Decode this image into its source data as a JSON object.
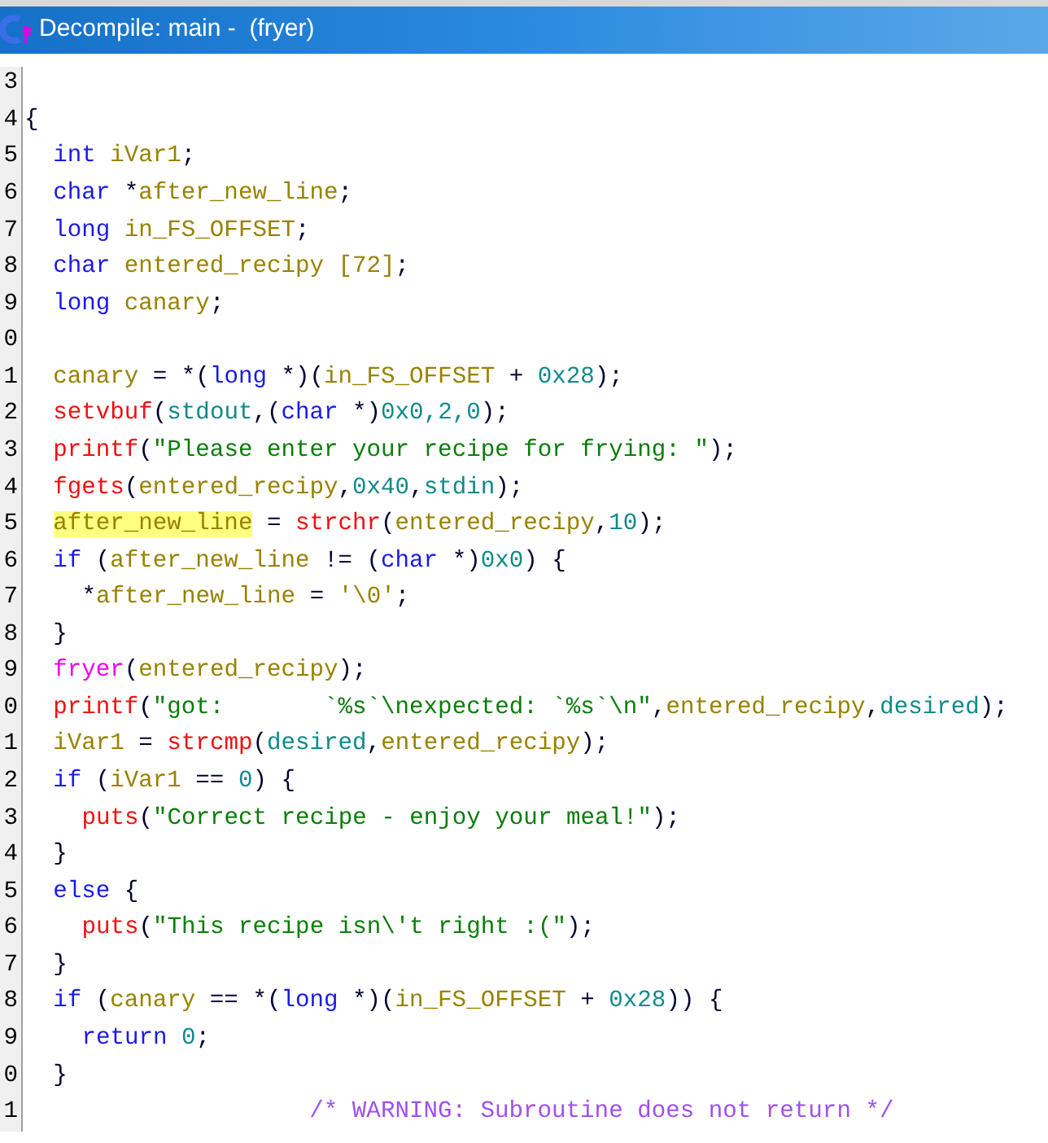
{
  "window": {
    "title": "Decompile: main -  (fryer)"
  },
  "lines": [
    {
      "number": "3"
    },
    {
      "number": "4",
      "tokens": [
        {
          "text": "{",
          "kind": "plain"
        }
      ],
      "children": [
        {
          "number": "5",
          "tokens": [
            {
              "text": "int",
              "kind": "keyword"
            },
            {
              "text": " iVar1",
              "kind": "variable"
            },
            {
              "text": ";",
              "kind": "plain"
            }
          ]
        },
        {
          "number": "6",
          "tokens": [
            {
              "text": "char",
              "kind": "keyword"
            },
            {
              "text": " *",
              "kind": "plain"
            },
            {
              "text": "after_new_line",
              "kind": "variable"
            },
            {
              "text": ";",
              "kind": "plain"
            }
          ]
        },
        {
          "number": "7",
          "tokens": [
            {
              "text": "long",
              "kind": "keyword"
            },
            {
              "text": " in_FS_OFFSET",
              "kind": "variable"
            },
            {
              "text": ";",
              "kind": "plain"
            }
          ]
        },
        {
          "number": "8",
          "tokens": [
            {
              "text": "char",
              "kind": "keyword"
            },
            {
              "text": " entered_recipy [72]",
              "kind": "variable"
            },
            {
              "text": ";",
              "kind": "plain"
            }
          ]
        },
        {
          "number": "9",
          "tokens": [
            {
              "text": "long",
              "kind": "keyword"
            },
            {
              "text": " canary",
              "kind": "variable"
            },
            {
              "text": ";",
              "kind": "plain"
            }
          ]
        },
        {
          "number": "0"
        },
        {
          "number": "1",
          "tokens": [
            {
              "text": "canary",
              "kind": "variable"
            },
            {
              "text": " = *(",
              "kind": "plain"
            },
            {
              "text": "long",
              "kind": "keyword"
            },
            {
              "text": " *)(",
              "kind": "plain"
            },
            {
              "text": "in_FS_OFFSET",
              "kind": "variable"
            },
            {
              "text": " + ",
              "kind": "plain"
            },
            {
              "text": "0x28",
              "kind": "constant"
            },
            {
              "text": ");",
              "kind": "plain"
            }
          ]
        },
        {
          "number": "2",
          "tokens": [
            {
              "text": "setvbuf",
              "kind": "function"
            },
            {
              "text": "(",
              "kind": "plain"
            },
            {
              "text": "stdout",
              "kind": "constant"
            },
            {
              "text": ",(",
              "kind": "plain"
            },
            {
              "text": "char",
              "kind": "keyword"
            },
            {
              "text": " *)",
              "kind": "plain"
            },
            {
              "text": "0x0,2,0",
              "kind": "constant"
            },
            {
              "text": ");",
              "kind": "plain"
            }
          ]
        },
        {
          "number": "3",
          "tokens": [
            {
              "text": "printf",
              "kind": "function"
            },
            {
              "text": "(",
              "kind": "plain"
            },
            {
              "text": "\"Please enter your recipe for frying: \"",
              "kind": "string"
            },
            {
              "text": ");",
              "kind": "plain"
            }
          ]
        },
        {
          "number": "4",
          "tokens": [
            {
              "text": "fgets",
              "kind": "function"
            },
            {
              "text": "(",
              "kind": "plain"
            },
            {
              "text": "entered_recipy",
              "kind": "variable"
            },
            {
              "text": ",",
              "kind": "plain"
            },
            {
              "text": "0x40",
              "kind": "constant"
            },
            {
              "text": ",",
              "kind": "plain"
            },
            {
              "text": "stdin",
              "kind": "constant"
            },
            {
              "text": ");",
              "kind": "plain"
            }
          ]
        },
        {
          "number": "5",
          "tokens": [
            {
              "text": "after_new_line",
              "kind": "variable",
              "highlighted": true
            },
            {
              "text": " = ",
              "kind": "plain"
            },
            {
              "text": "strchr",
              "kind": "function"
            },
            {
              "text": "(",
              "kind": "plain"
            },
            {
              "text": "entered_recipy",
              "kind": "variable"
            },
            {
              "text": ",",
              "kind": "plain"
            },
            {
              "text": "10",
              "kind": "constant"
            },
            {
              "text": ");",
              "kind": "plain"
            }
          ]
        },
        {
          "number": "6",
          "tokens": [
            {
              "text": "if",
              "kind": "keyword"
            },
            {
              "text": " (",
              "kind": "plain"
            },
            {
              "text": "after_new_line",
              "kind": "variable"
            },
            {
              "text": " != (",
              "kind": "plain"
            },
            {
              "text": "char",
              "kind": "keyword"
            },
            {
              "text": " *)",
              "kind": "plain"
            },
            {
              "text": "0x0",
              "kind": "constant"
            },
            {
              "text": ") {",
              "kind": "plain"
            }
          ],
          "children": [
            {
              "number": "7",
              "tokens": [
                {
                  "text": "*",
                  "kind": "plain"
                },
                {
                  "text": "after_new_line",
                  "kind": "variable"
                },
                {
                  "text": " = ",
                  "kind": "plain"
                },
                {
                  "text": "'\\0'",
                  "kind": "variable"
                },
                {
                  "text": ";",
                  "kind": "plain"
                }
              ]
            }
          ]
        },
        {
          "number": "8",
          "tokens": [
            {
              "text": "}",
              "kind": "plain"
            }
          ]
        },
        {
          "number": "9",
          "tokens": [
            {
              "text": "fryer",
              "kind": "user_function"
            },
            {
              "text": "(",
              "kind": "plain"
            },
            {
              "text": "entered_recipy",
              "kind": "variable"
            },
            {
              "text": ");",
              "kind": "plain"
            }
          ]
        },
        {
          "number": "0",
          "tokens": [
            {
              "text": "printf",
              "kind": "function"
            },
            {
              "text": "(",
              "kind": "plain"
            },
            {
              "text": "\"got:       `%s`\\nexpected: `%s`\\n\"",
              "kind": "string"
            },
            {
              "text": ",",
              "kind": "plain"
            },
            {
              "text": "entered_recipy",
              "kind": "variable"
            },
            {
              "text": ",",
              "kind": "plain"
            },
            {
              "text": "desired",
              "kind": "constant"
            },
            {
              "text": ");",
              "kind": "plain"
            }
          ]
        },
        {
          "number": "1",
          "tokens": [
            {
              "text": "iVar1",
              "kind": "variable"
            },
            {
              "text": " = ",
              "kind": "plain"
            },
            {
              "text": "strcmp",
              "kind": "function"
            },
            {
              "text": "(",
              "kind": "plain"
            },
            {
              "text": "desired",
              "kind": "constant"
            },
            {
              "text": ",",
              "kind": "plain"
            },
            {
              "text": "entered_recipy",
              "kind": "variable"
            },
            {
              "text": ");",
              "kind": "plain"
            }
          ]
        },
        {
          "number": "2",
          "tokens": [
            {
              "text": "if",
              "kind": "keyword"
            },
            {
              "text": " (",
              "kind": "plain"
            },
            {
              "text": "iVar1",
              "kind": "variable"
            },
            {
              "text": " == ",
              "kind": "plain"
            },
            {
              "text": "0",
              "kind": "constant"
            },
            {
              "text": ") {",
              "kind": "plain"
            }
          ],
          "children": [
            {
              "number": "3",
              "tokens": [
                {
                  "text": "puts",
                  "kind": "function"
                },
                {
                  "text": "(",
                  "kind": "plain"
                },
                {
                  "text": "\"Correct recipe - enjoy your meal!\"",
                  "kind": "string"
                },
                {
                  "text": ");",
                  "kind": "plain"
                }
              ]
            }
          ]
        },
        {
          "number": "4",
          "tokens": [
            {
              "text": "}",
              "kind": "plain"
            }
          ]
        },
        {
          "number": "5",
          "tokens": [
            {
              "text": "else",
              "kind": "keyword"
            },
            {
              "text": " {",
              "kind": "plain"
            }
          ],
          "children": [
            {
              "number": "6",
              "tokens": [
                {
                  "text": "puts",
                  "kind": "function"
                },
                {
                  "text": "(",
                  "kind": "plain"
                },
                {
                  "text": "\"This recipe isn\\'t right :(\"",
                  "kind": "string"
                },
                {
                  "text": ");",
                  "kind": "plain"
                }
              ]
            }
          ]
        },
        {
          "number": "7",
          "tokens": [
            {
              "text": "}",
              "kind": "plain"
            }
          ]
        },
        {
          "number": "8",
          "tokens": [
            {
              "text": "if",
              "kind": "keyword"
            },
            {
              "text": " (",
              "kind": "plain"
            },
            {
              "text": "canary",
              "kind": "variable"
            },
            {
              "text": " == *(",
              "kind": "plain"
            },
            {
              "text": "long",
              "kind": "keyword"
            },
            {
              "text": " *)(",
              "kind": "plain"
            },
            {
              "text": "in_FS_OFFSET",
              "kind": "variable"
            },
            {
              "text": " + ",
              "kind": "plain"
            },
            {
              "text": "0x28",
              "kind": "constant"
            },
            {
              "text": ")) {",
              "kind": "plain"
            }
          ],
          "children": [
            {
              "number": "9",
              "tokens": [
                {
                  "text": "return",
                  "kind": "keyword"
                },
                {
                  "text": " 0",
                  "kind": "constant"
                },
                {
                  "text": ";",
                  "kind": "plain"
                }
              ]
            }
          ]
        },
        {
          "number": "0",
          "tokens": [
            {
              "text": "}",
              "kind": "plain"
            }
          ]
        }
      ]
    },
    {
      "number": "1",
      "tokens": [
        {
          "text": "                    /* WARNING: Subroutine does not return */",
          "kind": "comment"
        }
      ]
    }
  ]
}
